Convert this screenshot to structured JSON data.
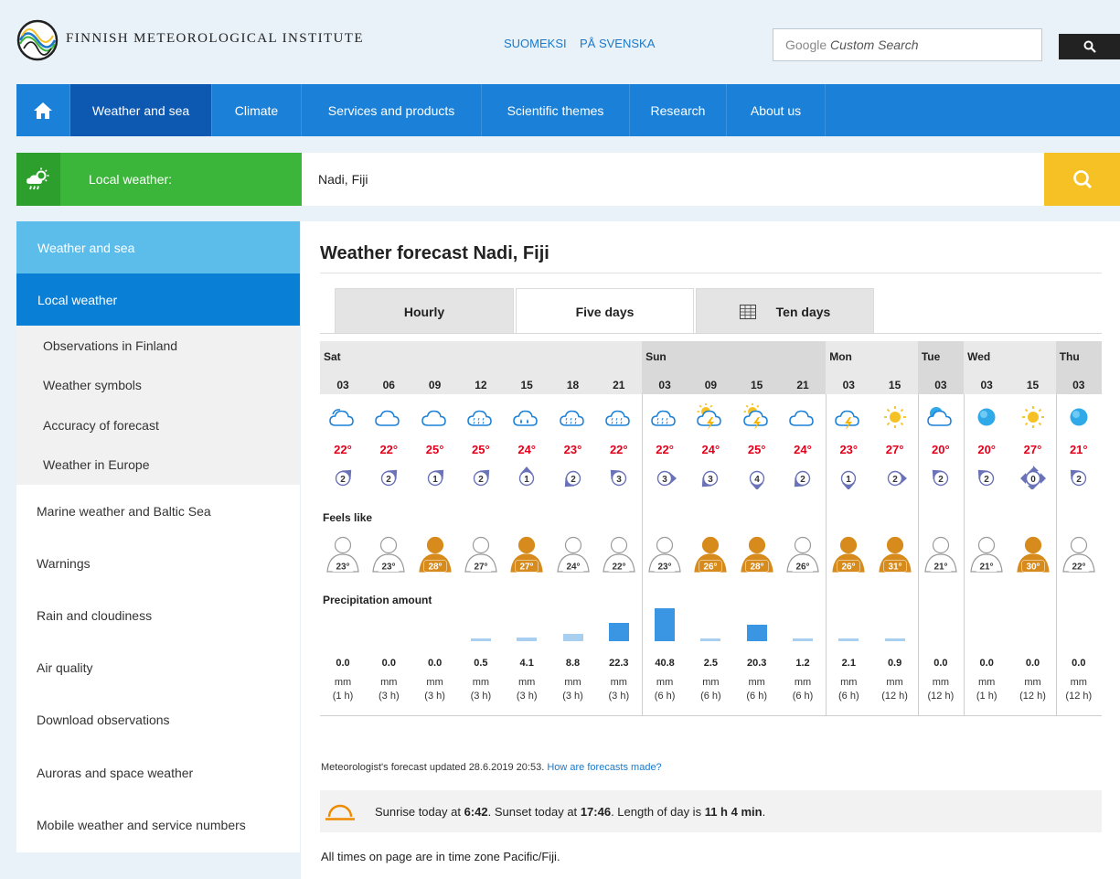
{
  "header": {
    "institute_name": "FINNISH METEOROLOGICAL INSTITUTE",
    "lang_links": [
      "SUOMEKSI",
      "PÅ SVENSKA"
    ],
    "search_prefix": "Google",
    "search_placeholder": "Custom Search",
    "search_icon": "magnifier-icon"
  },
  "nav": {
    "home_icon": "home-icon",
    "items": [
      "Weather and sea",
      "Climate",
      "Services and products",
      "Scientific themes",
      "Research",
      "About us"
    ],
    "active": "Weather and sea"
  },
  "local_weather": {
    "label": "Local weather:",
    "location_value": "Nadi, Fiji",
    "icon": "sun-cloud-rain-icon",
    "search_icon": "magnifier-icon"
  },
  "sidebar": {
    "section": "Weather and sea",
    "current": "Local weather",
    "sub_items": [
      "Observations in Finland",
      "Weather symbols",
      "Accuracy of forecast",
      "Weather in Europe"
    ],
    "items": [
      "Marine weather and Baltic Sea",
      "Warnings",
      "Rain and cloudiness",
      "Air quality",
      "Download observations",
      "Auroras and space weather",
      "Mobile weather and service numbers"
    ]
  },
  "main": {
    "title": "Weather forecast Nadi, Fiji",
    "tabs": [
      "Hourly",
      "Five days",
      "Ten days"
    ],
    "active_tab": "Five days",
    "tab_icon": "calendar-grid-icon",
    "feels_like_label": "Feels like",
    "precip_label": "Precipitation amount",
    "days": [
      {
        "name": "Sat",
        "cols": 7
      },
      {
        "name": "Sun",
        "cols": 4
      },
      {
        "name": "Mon",
        "cols": 2
      },
      {
        "name": "Tue",
        "cols": 1
      },
      {
        "name": "Wed",
        "cols": 2
      },
      {
        "name": "Thu",
        "cols": 1
      }
    ],
    "forecast": [
      {
        "hour": "03",
        "symbol": "partly-cloudy-icon",
        "temp": "22°",
        "wind": "2",
        "wind_dir": "ne",
        "feels": "23°",
        "feels_hot": false,
        "precip": "0.0",
        "unit": "mm",
        "period": "(1 h)"
      },
      {
        "hour": "06",
        "symbol": "cloudy-icon",
        "temp": "22°",
        "wind": "2",
        "wind_dir": "ne",
        "feels": "23°",
        "feels_hot": false,
        "precip": "0.0",
        "unit": "mm",
        "period": "(3 h)"
      },
      {
        "hour": "09",
        "symbol": "cloudy-icon",
        "temp": "25°",
        "wind": "1",
        "wind_dir": "ne",
        "feels": "28°",
        "feels_hot": true,
        "precip": "0.0",
        "unit": "mm",
        "period": "(3 h)"
      },
      {
        "hour": "12",
        "symbol": "cloud-drizzle-icon",
        "temp": "25°",
        "wind": "2",
        "wind_dir": "ne",
        "feels": "27°",
        "feels_hot": false,
        "precip": "0.5",
        "unit": "mm",
        "period": "(3 h)"
      },
      {
        "hour": "15",
        "symbol": "cloud-showers-icon",
        "temp": "24°",
        "wind": "1",
        "wind_dir": "n",
        "feels": "27°",
        "feels_hot": true,
        "precip": "4.1",
        "unit": "mm",
        "period": "(3 h)"
      },
      {
        "hour": "18",
        "symbol": "cloud-drizzle-icon",
        "temp": "23°",
        "wind": "2",
        "wind_dir": "sw",
        "feels": "24°",
        "feels_hot": false,
        "precip": "8.8",
        "unit": "mm",
        "period": "(3 h)"
      },
      {
        "hour": "21",
        "symbol": "cloud-drizzle-icon",
        "temp": "22°",
        "wind": "3",
        "wind_dir": "nw",
        "feels": "22°",
        "feels_hot": false,
        "precip": "22.3",
        "unit": "mm",
        "period": "(3 h)"
      },
      {
        "hour": "03",
        "symbol": "cloud-drizzle-icon",
        "temp": "22°",
        "wind": "3",
        "wind_dir": "e",
        "feels": "23°",
        "feels_hot": false,
        "precip": "40.8",
        "unit": "mm",
        "period": "(6 h)"
      },
      {
        "hour": "09",
        "symbol": "sun-cloud-thunder-icon",
        "temp": "24°",
        "wind": "3",
        "wind_dir": "sw",
        "feels": "26°",
        "feels_hot": true,
        "precip": "2.5",
        "unit": "mm",
        "period": "(6 h)"
      },
      {
        "hour": "15",
        "symbol": "sun-cloud-thunder-icon",
        "temp": "25°",
        "wind": "4",
        "wind_dir": "s",
        "feels": "28°",
        "feels_hot": true,
        "precip": "20.3",
        "unit": "mm",
        "period": "(6 h)"
      },
      {
        "hour": "21",
        "symbol": "cloudy-icon",
        "temp": "24°",
        "wind": "2",
        "wind_dir": "sw",
        "feels": "26°",
        "feels_hot": false,
        "precip": "1.2",
        "unit": "mm",
        "period": "(6 h)"
      },
      {
        "hour": "03",
        "symbol": "cloud-thunder-icon",
        "temp": "23°",
        "wind": "1",
        "wind_dir": "s",
        "feels": "26°",
        "feels_hot": true,
        "precip": "2.1",
        "unit": "mm",
        "period": "(6 h)"
      },
      {
        "hour": "15",
        "symbol": "sun-icon",
        "temp": "27°",
        "wind": "2",
        "wind_dir": "e",
        "feels": "31°",
        "feels_hot": true,
        "precip": "0.9",
        "unit": "mm",
        "period": "(12 h)"
      },
      {
        "hour": "03",
        "symbol": "moon-cloud-icon",
        "temp": "20°",
        "wind": "2",
        "wind_dir": "nw",
        "feels": "21°",
        "feels_hot": false,
        "precip": "0.0",
        "unit": "mm",
        "period": "(12 h)"
      },
      {
        "hour": "03",
        "symbol": "clear-night-icon",
        "temp": "20°",
        "wind": "2",
        "wind_dir": "nw",
        "feels": "21°",
        "feels_hot": false,
        "precip": "0.0",
        "unit": "mm",
        "period": "(1 h)"
      },
      {
        "hour": "15",
        "symbol": "sun-icon",
        "temp": "27°",
        "wind": "0",
        "wind_dir": "calm",
        "feels": "30°",
        "feels_hot": true,
        "precip": "0.0",
        "unit": "mm",
        "period": "(12 h)"
      },
      {
        "hour": "03",
        "symbol": "clear-night-icon",
        "temp": "21°",
        "wind": "2",
        "wind_dir": "nw",
        "feels": "22°",
        "feels_hot": false,
        "precip": "0.0",
        "unit": "mm",
        "period": "(12 h)"
      }
    ],
    "updated_text": "Meteorologist's forecast updated 28.6.2019 20:53.",
    "updated_link": "How are forecasts made?",
    "sun": {
      "prefix": "Sunrise today at",
      "sunrise": "6:42",
      "mid": ". Sunset today at",
      "sunset": "17:46",
      "mid2": ". Length of day is",
      "length": "11 h 4 min",
      "suffix": ".",
      "icon": "sunrise-icon"
    },
    "timezone_note": "All times on page are in time zone Pacific/Fiji."
  },
  "colors": {
    "nav_blue": "#1a80d8",
    "nav_active": "#0d58b0",
    "sidebar_section": "#5cbdea",
    "sidebar_current": "#0a7fd6",
    "green": "#3cb53b",
    "yellow": "#f6c124",
    "temp_red": "#e4001b",
    "feels_hot": "#d68b1c",
    "wind_blue": "#6b73b8"
  }
}
